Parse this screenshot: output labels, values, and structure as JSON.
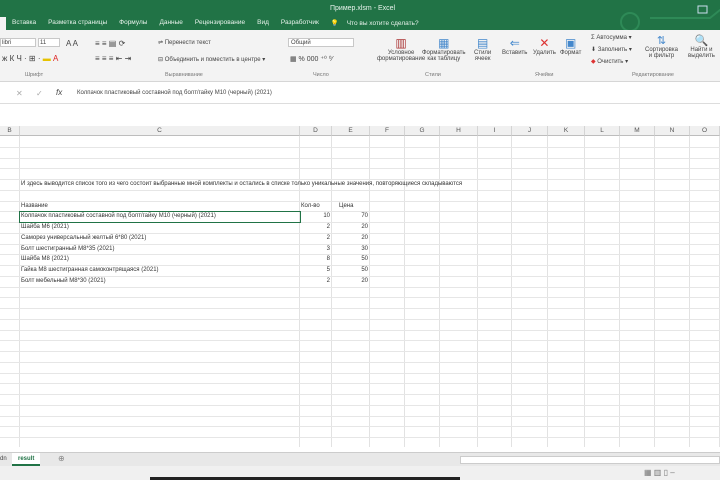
{
  "window": {
    "title": "Пример.xlsm - Excel"
  },
  "tabs": [
    "Вставка",
    "Разметка страницы",
    "Формулы",
    "Данные",
    "Рецензирование",
    "Вид",
    "Разработчик"
  ],
  "tell_me": "Что вы хотите сделать?",
  "ribbon": {
    "font_name": "libri",
    "font_size": "11",
    "wrap_text": "Перенести текст",
    "merge": "Объединить и поместить в центре",
    "number_format": "Общий",
    "cond_format": [
      "Условное",
      "форматирование"
    ],
    "format_table": [
      "Форматировать",
      "как таблицу"
    ],
    "cell_styles": [
      "Стили",
      "ячеек"
    ],
    "insert": "Вставить",
    "delete": "Удалить",
    "format": "Формат",
    "autosum": "Автосумма",
    "fill": "Заполнить",
    "clear": "Очистить",
    "sort": [
      "Сортировка",
      "и фильтр"
    ],
    "find": [
      "Найти и",
      "выделить"
    ],
    "groups": {
      "font": "Шрифт",
      "alignment": "Выравнивание",
      "number": "Число",
      "styles": "Стили",
      "cells": "Ячейки",
      "editing": "Редактирование"
    }
  },
  "formula_bar": {
    "value": "Колпачок пластиковый составной под болт/гайку М10 (черный) (2021)"
  },
  "columns": [
    "B",
    "C",
    "D",
    "E",
    "F",
    "G",
    "H",
    "I",
    "J",
    "K",
    "L",
    "M",
    "N",
    "O"
  ],
  "sheet": {
    "note": "И здесь выводится список того из чего состоит выбранные мной комплекты и остались в списке только уникальные значения, повторяющиеся складываются",
    "headers": [
      "Название",
      "Кол-во",
      "Цена"
    ],
    "rows": [
      [
        "Колпачок пластиковый составной под болт/гайку М10 (черный) (2021)",
        "10",
        "70"
      ],
      [
        "Шайба М6 (2021)",
        "2",
        "20"
      ],
      [
        "Саморез универсальный желтый 6*80 (2021)",
        "2",
        "20"
      ],
      [
        "Болт шестигранный М8*35 (2021)",
        "3",
        "30"
      ],
      [
        "Шайба М8 (2021)",
        "8",
        "50"
      ],
      [
        "Гайка М8 шестигранная самоконтрящаяся (2021)",
        "5",
        "50"
      ],
      [
        "Болт мебельный М8*30 (2021)",
        "2",
        "20"
      ]
    ]
  },
  "sheet_tabs": {
    "prev": "dn",
    "active": "result"
  }
}
